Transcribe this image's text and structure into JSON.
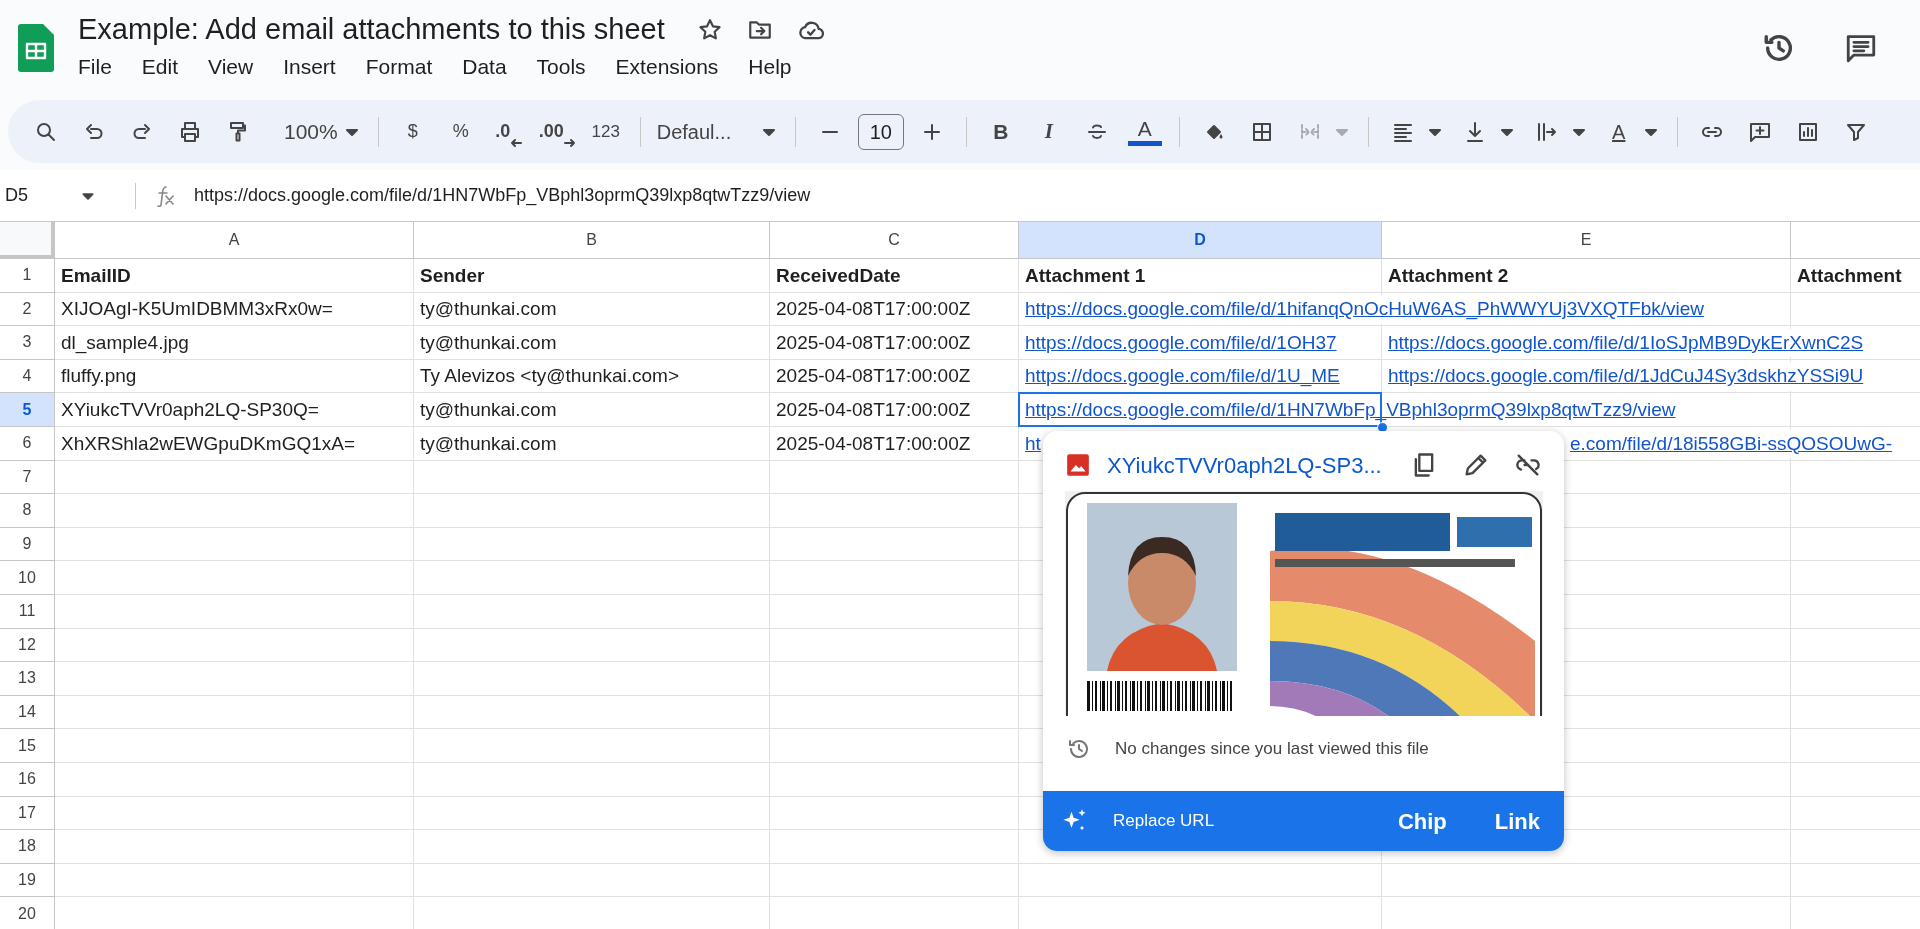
{
  "document": {
    "title": "Example: Add email attachments to this sheet",
    "menu": [
      "File",
      "Edit",
      "View",
      "Insert",
      "Format",
      "Data",
      "Tools",
      "Extensions",
      "Help"
    ]
  },
  "toolbar": {
    "zoom": "100%",
    "currency": "$",
    "percent": "%",
    "decrease_decimals": ".0",
    "increase_decimals": ".00",
    "number_format": "123",
    "font": "Defaul...",
    "font_size": "10",
    "bold": "B",
    "italic": "I",
    "text_color": "A",
    "text_rotation": "A",
    "merge_disabled": true
  },
  "formula_bar": {
    "cell_reference": "D5",
    "formula": "https://docs.google.com/file/d/1HN7WbFp_VBphl3oprmQ39lxp8qtwTzz9/view"
  },
  "sheet": {
    "columns": [
      {
        "label": "A",
        "selected": false
      },
      {
        "label": "B",
        "selected": false
      },
      {
        "label": "C",
        "selected": false
      },
      {
        "label": "D",
        "selected": true
      },
      {
        "label": "E",
        "selected": false
      }
    ],
    "rows": [
      {
        "number": "1",
        "selected": false,
        "kind": "header",
        "cells": [
          {
            "text": "EmailID",
            "kind": "text",
            "selected": false
          },
          {
            "text": "Sender",
            "kind": "text",
            "selected": false
          },
          {
            "text": "ReceivedDate",
            "kind": "text",
            "selected": false
          },
          {
            "text": "Attachment 1",
            "kind": "text",
            "selected": false
          },
          {
            "text": "Attachment 2",
            "kind": "text",
            "selected": false
          },
          {
            "text": "Attachment",
            "kind": "text",
            "selected": false
          }
        ]
      },
      {
        "number": "2",
        "selected": false,
        "kind": "data",
        "cells": [
          {
            "text": "XIJOAgI-K5UmIDBMM3xRx0w=",
            "kind": "text",
            "selected": false
          },
          {
            "text": "ty@thunkai.com",
            "kind": "text",
            "selected": false
          },
          {
            "text": "2025-04-08T17:00:00Z",
            "kind": "text",
            "selected": false
          },
          {
            "text": "https://docs.google.com/file/d/1hifanqQnOcHuW6AS_PhWWYUj3VXQTFbk/view",
            "kind": "link",
            "selected": false
          }
        ]
      },
      {
        "number": "3",
        "selected": false,
        "kind": "data",
        "cells": [
          {
            "text": "dl_sample4.jpg",
            "kind": "text",
            "selected": false
          },
          {
            "text": "ty@thunkai.com",
            "kind": "text",
            "selected": false
          },
          {
            "text": "2025-04-08T17:00:00Z",
            "kind": "text",
            "selected": false
          },
          {
            "text": "https://docs.google.com/file/d/1OH37",
            "kind": "link",
            "selected": false
          },
          {
            "text": "https://docs.google.com/file/d/1IoSJpMB9DykErXwnC2S",
            "kind": "link",
            "selected": false
          }
        ]
      },
      {
        "number": "4",
        "selected": false,
        "kind": "data",
        "cells": [
          {
            "text": "fluffy.png",
            "kind": "text",
            "selected": false
          },
          {
            "text": "Ty Alevizos <ty@thunkai.com>",
            "kind": "text",
            "selected": false
          },
          {
            "text": "2025-04-08T17:00:00Z",
            "kind": "text",
            "selected": false
          },
          {
            "text": "https://docs.google.com/file/d/1U_ME",
            "kind": "link",
            "selected": false
          },
          {
            "text": "https://docs.google.com/file/d/1JdCuJ4Sy3dskhzYSSi9U",
            "kind": "link",
            "selected": false
          }
        ]
      },
      {
        "number": "5",
        "selected": true,
        "kind": "data",
        "cells": [
          {
            "text": "XYiukcTVVr0aph2LQ-SP30Q=",
            "kind": "text",
            "selected": false
          },
          {
            "text": "ty@thunkai.com",
            "kind": "text",
            "selected": false
          },
          {
            "text": "2025-04-08T17:00:00Z",
            "kind": "text",
            "selected": false
          },
          {
            "text": "https://docs.google.com/file/d/1HN7WbFp_VBphl3oprmQ39lxp8qtwTzz9/view",
            "kind": "link",
            "selected": true
          }
        ]
      },
      {
        "number": "6",
        "selected": false,
        "kind": "data",
        "cells": [
          {
            "text": "XhXRShla2wEWGpuDKmGQ1xA=",
            "kind": "text",
            "selected": false
          },
          {
            "text": "ty@thunkai.com",
            "kind": "text",
            "selected": false
          },
          {
            "text": "2025-04-08T17:00:00Z",
            "kind": "text",
            "selected": false
          },
          {
            "text": "ht",
            "kind": "link",
            "selected": false
          },
          {
            "text": "e.com/file/d/18i558GBi-ssQOSOUwG-",
            "kind": "link_tail",
            "selected": false
          }
        ]
      },
      {
        "number": "7",
        "selected": false,
        "kind": "data"
      },
      {
        "number": "8",
        "selected": false,
        "kind": "data"
      },
      {
        "number": "9",
        "selected": false,
        "kind": "data"
      },
      {
        "number": "10",
        "selected": false,
        "kind": "data"
      },
      {
        "number": "11",
        "selected": false,
        "kind": "data"
      },
      {
        "number": "12",
        "selected": false,
        "kind": "data"
      },
      {
        "number": "13",
        "selected": false,
        "kind": "data"
      },
      {
        "number": "14",
        "selected": false,
        "kind": "data"
      },
      {
        "number": "15",
        "selected": false,
        "kind": "data"
      },
      {
        "number": "16",
        "selected": false,
        "kind": "data"
      },
      {
        "number": "17",
        "selected": false,
        "kind": "data"
      },
      {
        "number": "18",
        "selected": false,
        "kind": "data"
      },
      {
        "number": "19",
        "selected": false,
        "kind": "data"
      },
      {
        "number": "20",
        "selected": false,
        "kind": "data"
      }
    ]
  },
  "link_popup": {
    "title": "XYiukcTVVr0aph2LQ-SP3...",
    "status": "No changes since you last viewed this file",
    "action": "Replace URL",
    "options": [
      "Chip",
      "Link"
    ]
  }
}
